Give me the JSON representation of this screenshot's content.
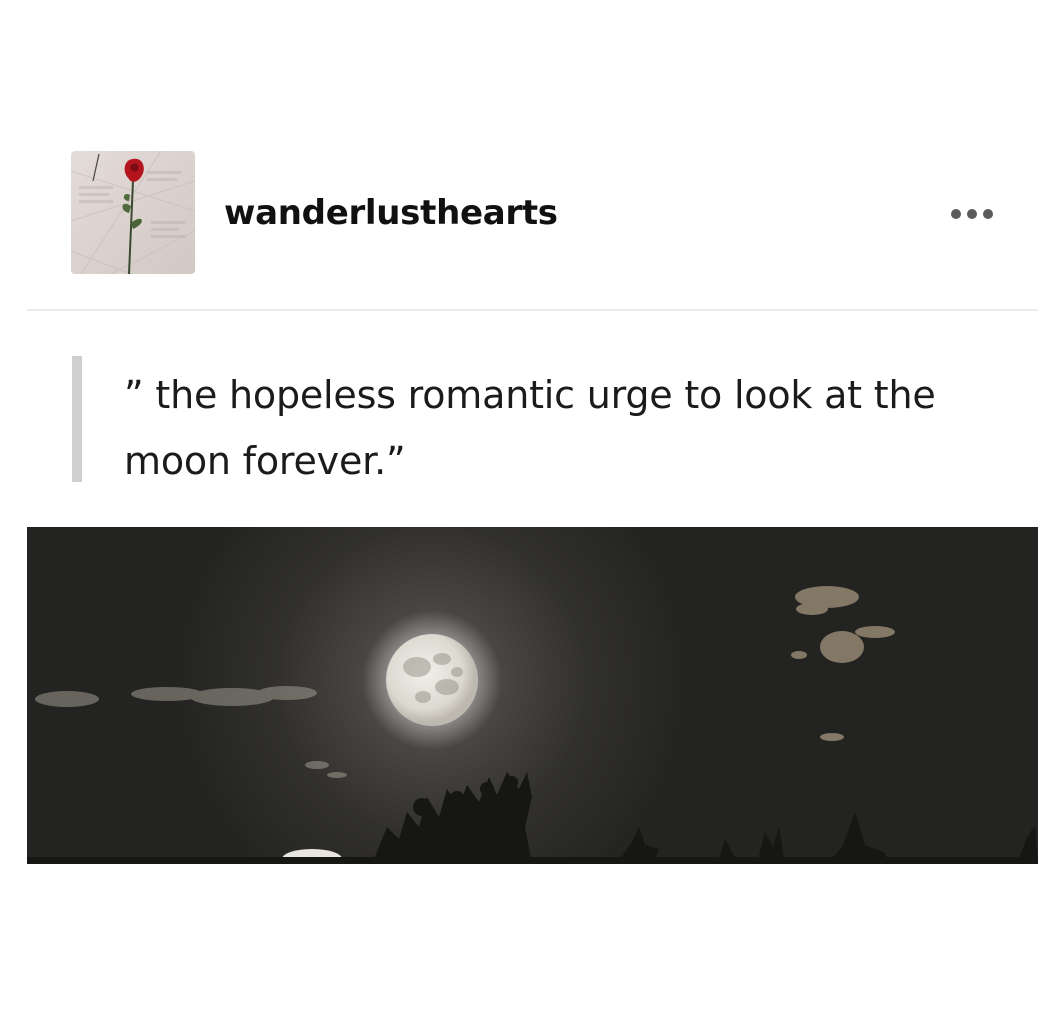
{
  "post": {
    "username": "wanderlusthearts",
    "avatar_icon": "rose-on-newspaper-avatar",
    "more_icon": "ellipsis-icon",
    "quote_text": "” the hopeless romantic urge to look at the moon forever.”",
    "image_subject": "full-moon-night-sky-photo"
  },
  "colors": {
    "background": "#ffffff",
    "text": "#1b1b1b",
    "quote_bar": "#cfcfcf",
    "divider": "#ececec",
    "sky": "#262624"
  }
}
